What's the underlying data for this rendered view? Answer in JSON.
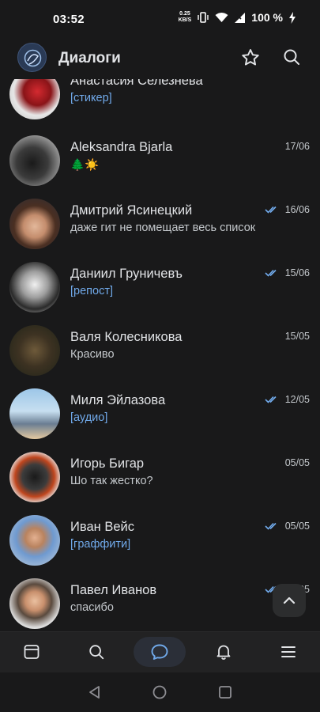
{
  "status_bar": {
    "time": "03:52",
    "net_speed_value": "0.25",
    "net_speed_unit": "KB/S",
    "battery": "100 %"
  },
  "header": {
    "title": "Диалоги",
    "icons": [
      "star-icon",
      "search-icon"
    ]
  },
  "dialogs": [
    {
      "name": "Анастасия Селезнева",
      "preview": "[стикер]",
      "preview_is_link": true,
      "date": "",
      "read_ticks": false
    },
    {
      "name": "Aleksandra Bjarla",
      "preview": "🌲☀️",
      "preview_is_link": false,
      "date": "17/06",
      "read_ticks": false
    },
    {
      "name": "Дмитрий Ясинецкий",
      "preview": "даже гит не помещает весь список",
      "preview_is_link": false,
      "date": "16/06",
      "read_ticks": true
    },
    {
      "name": "Даниил Груничевъ",
      "preview": "[репост]",
      "preview_is_link": true,
      "date": "15/06",
      "read_ticks": true
    },
    {
      "name": "Валя Колесникова",
      "preview": "Красиво",
      "preview_is_link": false,
      "date": "15/05",
      "read_ticks": false
    },
    {
      "name": "Миля Эйлазова",
      "preview": "[аудио]",
      "preview_is_link": true,
      "date": "12/05",
      "read_ticks": true
    },
    {
      "name": "Игорь Бигар",
      "preview": "Шо так жестко?",
      "preview_is_link": false,
      "date": "05/05",
      "read_ticks": false
    },
    {
      "name": "Иван Вейс",
      "preview": "[граффити]",
      "preview_is_link": true,
      "date": "05/05",
      "read_ticks": true
    },
    {
      "name": "Павел Иванов",
      "preview": "спасибо",
      "preview_is_link": false,
      "date": "05/05",
      "read_ticks": true
    }
  ],
  "bottom_nav": [
    {
      "icon": "news-icon",
      "active": false
    },
    {
      "icon": "search-icon",
      "active": false
    },
    {
      "icon": "messages-icon",
      "active": true
    },
    {
      "icon": "bell-icon",
      "active": false
    },
    {
      "icon": "menu-icon",
      "active": false
    }
  ],
  "colors": {
    "background": "#19191a",
    "accent": "#71aaeb",
    "text_primary": "#e1e3e6",
    "text_secondary": "#c4c8cc"
  }
}
